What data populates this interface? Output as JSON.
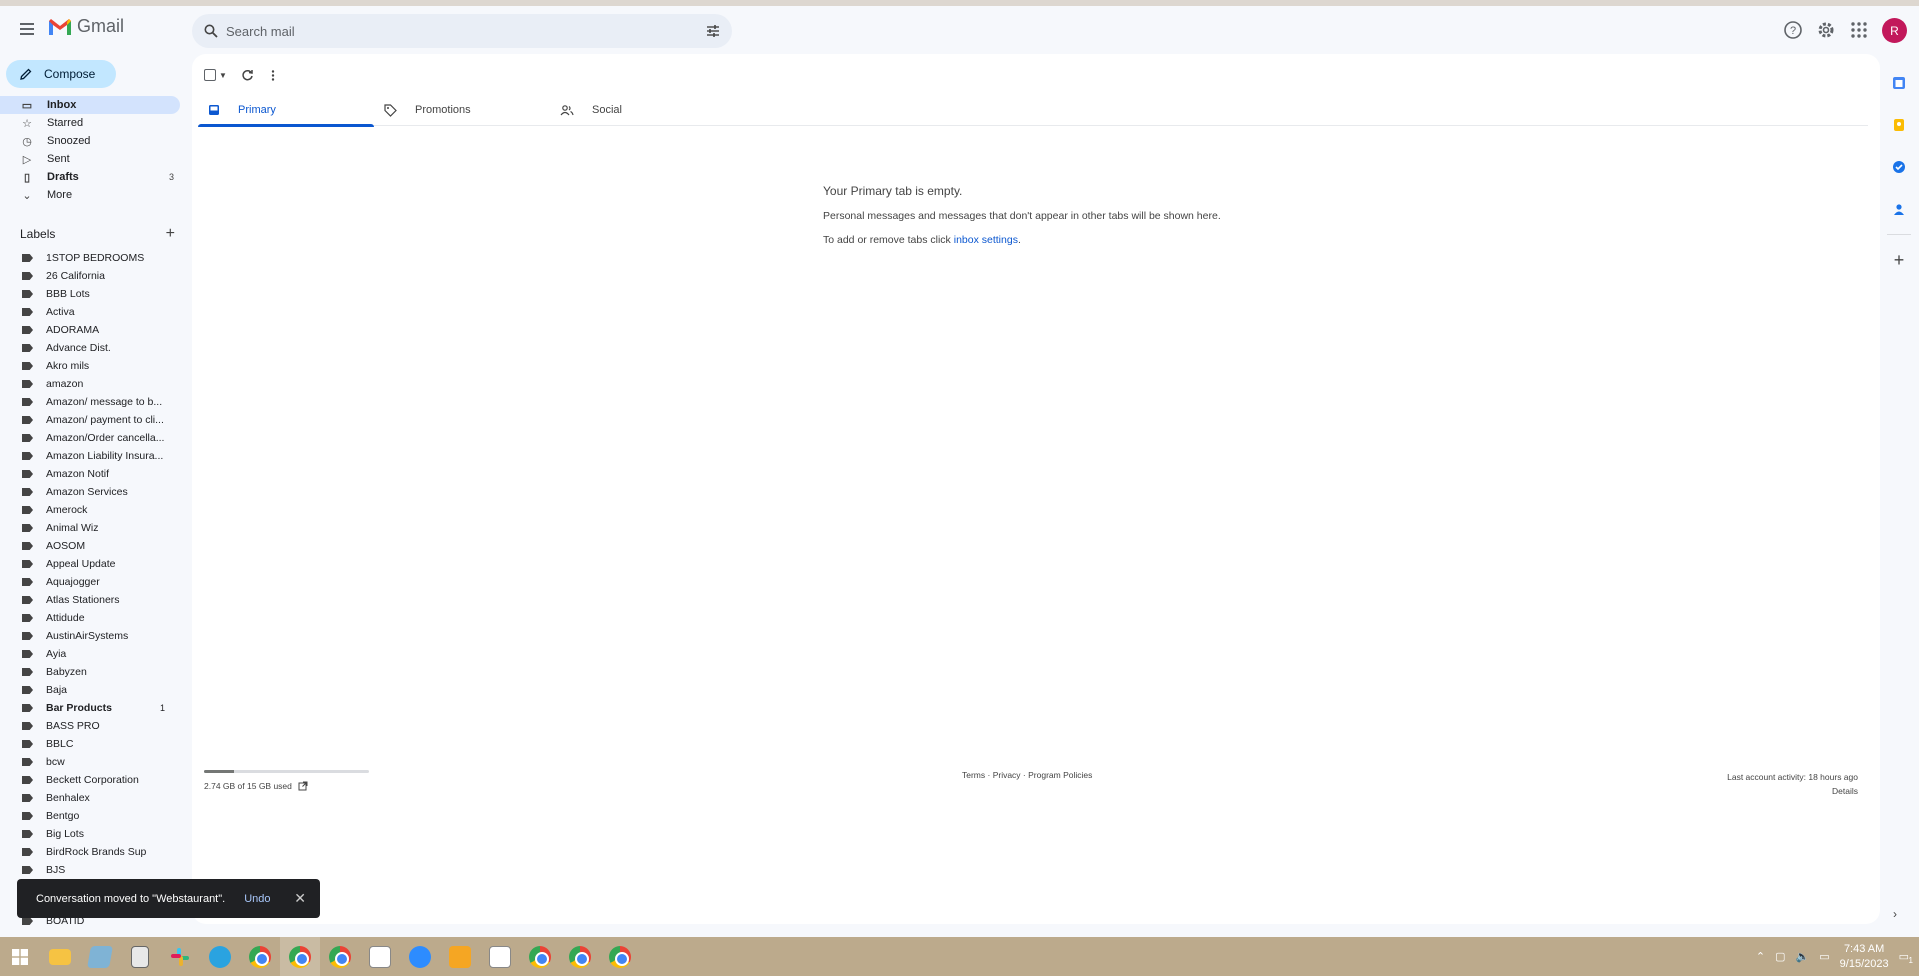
{
  "header": {
    "app_name": "Gmail",
    "search_placeholder": "Search mail",
    "avatar_letter": "R"
  },
  "compose_label": "Compose",
  "nav": [
    {
      "label": "Inbox",
      "icon": "inbox-icon",
      "active": true,
      "count": ""
    },
    {
      "label": "Starred",
      "icon": "star-icon",
      "active": false,
      "count": ""
    },
    {
      "label": "Snoozed",
      "icon": "clock-icon",
      "active": false,
      "count": ""
    },
    {
      "label": "Sent",
      "icon": "send-icon",
      "active": false,
      "count": ""
    },
    {
      "label": "Drafts",
      "icon": "draft-icon",
      "active": false,
      "bold": true,
      "count": "3"
    },
    {
      "label": "More",
      "icon": "chevron-down-icon",
      "active": false,
      "count": ""
    }
  ],
  "labels_heading": "Labels",
  "labels": [
    {
      "name": "1STOP BEDROOMS",
      "count": ""
    },
    {
      "name": "26 California",
      "count": ""
    },
    {
      "name": "BBB Lots",
      "count": ""
    },
    {
      "name": "Activa",
      "count": ""
    },
    {
      "name": "ADORAMA",
      "count": ""
    },
    {
      "name": "Advance Dist.",
      "count": ""
    },
    {
      "name": "Akro mils",
      "count": ""
    },
    {
      "name": "amazon",
      "count": ""
    },
    {
      "name": "Amazon/ message to b...",
      "count": ""
    },
    {
      "name": "Amazon/ payment to cli...",
      "count": ""
    },
    {
      "name": "Amazon/Order cancella...",
      "count": ""
    },
    {
      "name": "Amazon Liability Insura...",
      "count": ""
    },
    {
      "name": "Amazon Notif",
      "count": ""
    },
    {
      "name": "Amazon Services",
      "count": ""
    },
    {
      "name": "Amerock",
      "count": ""
    },
    {
      "name": "Animal Wiz",
      "count": ""
    },
    {
      "name": "AOSOM",
      "count": ""
    },
    {
      "name": "Appeal Update",
      "count": ""
    },
    {
      "name": "Aquajogger",
      "count": ""
    },
    {
      "name": "Atlas Stationers",
      "count": ""
    },
    {
      "name": "Attidude",
      "count": ""
    },
    {
      "name": "AustinAirSystems",
      "count": ""
    },
    {
      "name": "Ayia",
      "count": ""
    },
    {
      "name": "Babyzen",
      "count": ""
    },
    {
      "name": "Baja",
      "count": ""
    },
    {
      "name": "Bar Products",
      "count": "1",
      "bold": true
    },
    {
      "name": "BASS PRO",
      "count": ""
    },
    {
      "name": "BBLC",
      "count": ""
    },
    {
      "name": "bcw",
      "count": ""
    },
    {
      "name": "Beckett Corporation",
      "count": ""
    },
    {
      "name": "Benhalex",
      "count": ""
    },
    {
      "name": "Bentgo",
      "count": ""
    },
    {
      "name": "Big Lots",
      "count": ""
    },
    {
      "name": "BirdRock Brands Sup",
      "count": ""
    },
    {
      "name": "BJS",
      "count": ""
    }
  ],
  "tabs": [
    {
      "label": "Primary",
      "icon": "inbox-icon",
      "active": true
    },
    {
      "label": "Promotions",
      "icon": "tag-icon",
      "active": false
    },
    {
      "label": "Social",
      "icon": "people-icon",
      "active": false
    }
  ],
  "empty_state": {
    "title": "Your Primary tab is empty.",
    "body": "Personal messages and messages that don't appear in other tabs will be shown here.",
    "link_prefix": "To add or remove tabs click ",
    "link_text": "inbox settings",
    "link_suffix": "."
  },
  "footer": {
    "storage_text": "2.74 GB of 15 GB used",
    "storage_used_fraction": 0.183,
    "links": "Terms · Privacy · Program Policies",
    "last_activity": "Last account activity: 18 hours ago",
    "details": "Details"
  },
  "snackbar": {
    "message": "Conversation moved to \"Webstaurant\".",
    "action": "Undo",
    "close": "✕"
  },
  "partial_label": "BOATID",
  "taskbar": {
    "time": "7:43 AM",
    "date": "9/15/2023",
    "notification_count": "1"
  },
  "colors": {
    "accent": "#0b57d0",
    "compose_bg": "#c2e7ff",
    "active_nav": "#d3e3fd",
    "taskbar": "#bcaa8c"
  }
}
